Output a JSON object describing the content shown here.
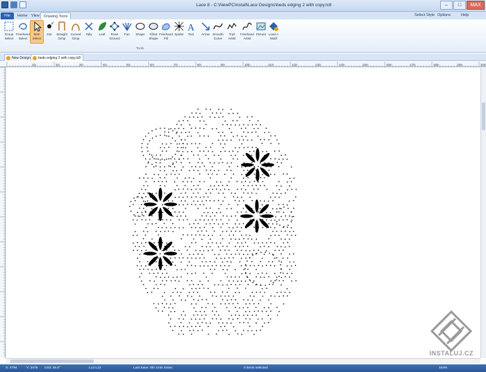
{
  "window": {
    "title": "Lace 8 - C:\\NewPCInstall\\Lace Designs\\beds edging 2 with copy.lc8",
    "minimize": "–",
    "maximize": "□",
    "close": "MAX"
  },
  "tabs": {
    "file": "File",
    "home": "Home",
    "view": "View",
    "drawing_tools": "Drawing Tools"
  },
  "right_controls": {
    "select_style": "Select Style",
    "options": "Options",
    "help": "Help"
  },
  "tools": [
    {
      "label": "Group Select",
      "icon": "group-select-icon"
    },
    {
      "label": "Freehand Select",
      "icon": "freehand-select-icon"
    },
    {
      "label": "Item Select",
      "icon": "item-select-icon",
      "selected": true
    },
    {
      "label": "Dot",
      "icon": "dot-icon"
    },
    {
      "label": "Straight Gimp",
      "icon": "straight-gimp-icon"
    },
    {
      "label": "Curved Gimp",
      "icon": "curved-gimp-icon"
    },
    {
      "label": "Tally",
      "icon": "tally-icon"
    },
    {
      "label": "Leaf",
      "icon": "leaf-icon"
    },
    {
      "label": "Rose Ground",
      "icon": "rose-ground-icon"
    },
    {
      "label": "Fan",
      "icon": "fan-icon"
    },
    {
      "label": "Shape",
      "icon": "shape-icon"
    },
    {
      "label": "Filled Shape",
      "icon": "filled-shape-icon"
    },
    {
      "label": "Freehand Fill",
      "icon": "freehand-fill-icon"
    },
    {
      "label": "Spider",
      "icon": "spider-icon"
    },
    {
      "label": "Text",
      "icon": "text-icon"
    },
    {
      "label": "Arrow",
      "icon": "arrow-icon"
    },
    {
      "label": "Smooth Curve",
      "icon": "smooth-curve-icon"
    },
    {
      "label": "Trail Artist",
      "icon": "trail-artist-icon"
    },
    {
      "label": "Freehand Artist",
      "icon": "freehand-artist-icon"
    },
    {
      "label": "Picture",
      "icon": "picture-icon"
    },
    {
      "label": "Load A Motif",
      "icon": "load-motif-icon"
    }
  ],
  "tools_group_label": "Tools",
  "doc_tabs": [
    "New Design",
    "beds edging 2 with copy.lc8"
  ],
  "ruler_labels": [
    "1in",
    "2in",
    "3in",
    "4in",
    "5in",
    "6in",
    "7in",
    "8in",
    "9in",
    "10in",
    "11in",
    "12in",
    "13in",
    "14in",
    "15in",
    "16in",
    "17in",
    "18in",
    "19in",
    "20in"
  ],
  "status": {
    "x": "X: 4794",
    "y": "Y: 3476",
    "grid": "Grid: 45.0°",
    "coord": "L13 L13",
    "last_save": "Last Save: 0hr 1min 44sec",
    "items": "0 items selected",
    "zoom": "104%"
  },
  "watermark": {
    "text": "INSTALUJ.CZ"
  },
  "colors": {
    "ribbon_accent": "#2a60b2",
    "selected_tool": "#f7c986",
    "status_bar": "#2b5796"
  }
}
